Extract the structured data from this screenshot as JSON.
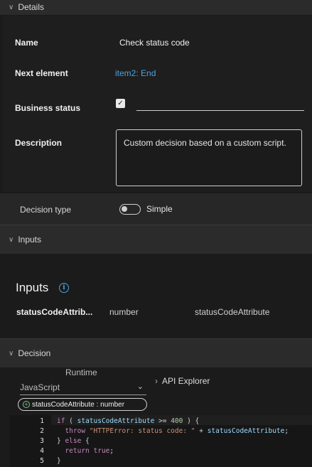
{
  "details": {
    "header": "Details",
    "name_label": "Name",
    "name_value": "Check status code",
    "next_label": "Next element",
    "next_value": "item2: End",
    "business_label": "Business status",
    "business_checked": true,
    "business_value": "",
    "description_label": "Description",
    "description_value": "Custom decision based on a custom script.",
    "decision_type_label": "Decision type",
    "decision_type_value": "Simple",
    "decision_type_on": false
  },
  "inputs": {
    "header": "Inputs",
    "title": "Inputs",
    "info_icon": "info-icon",
    "rows": [
      {
        "name": "statusCodeAttrib...",
        "type": "number",
        "binding": "statusCodeAttribute"
      }
    ]
  },
  "decision": {
    "header": "Decision",
    "runtime_label": "Runtime",
    "runtime_value": "JavaScript",
    "api_explorer": "API Explorer",
    "variable_pill": "statusCodeAttribute : number",
    "code_lines": [
      "1",
      "2",
      "3",
      "4",
      "5"
    ]
  },
  "colors": {
    "accent": "#4aa3df",
    "header_bg": "#2b2b2b",
    "body_bg": "#1b1b1b"
  }
}
